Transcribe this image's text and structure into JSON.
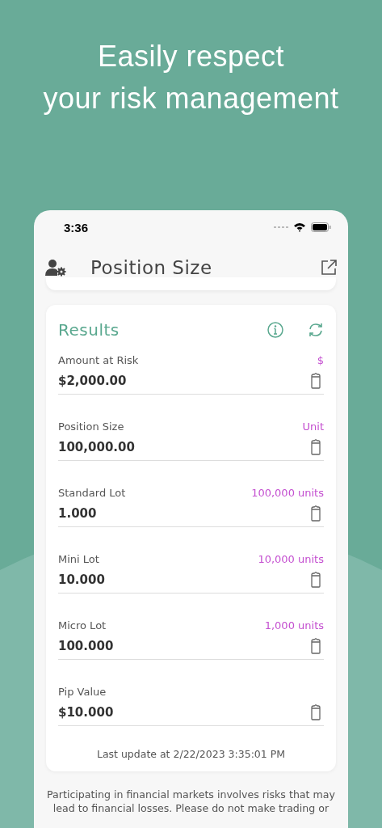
{
  "headline": "Easily respect\nyour risk management",
  "status_bar": {
    "time": "3:36"
  },
  "nav": {
    "title": "Position Size"
  },
  "results": {
    "title": "Results",
    "rows": [
      {
        "label": "Amount at Risk",
        "unit": "$",
        "value": "$2,000.00"
      },
      {
        "label": "Position Size",
        "unit": "Unit",
        "value": "100,000.00"
      },
      {
        "label": "Standard Lot",
        "unit": "100,000 units",
        "value": "1.000"
      },
      {
        "label": "Mini Lot",
        "unit": "10,000 units",
        "value": "10.000"
      },
      {
        "label": "Micro Lot",
        "unit": "1,000 units",
        "value": "100.000"
      },
      {
        "label": "Pip Value",
        "value": "$10.000"
      }
    ],
    "last_update": "Last update at 2/22/2023 3:35:01 PM"
  },
  "disclaimer": "Participating in financial markets involves risks that may lead to financial losses. Please do not make trading or"
}
